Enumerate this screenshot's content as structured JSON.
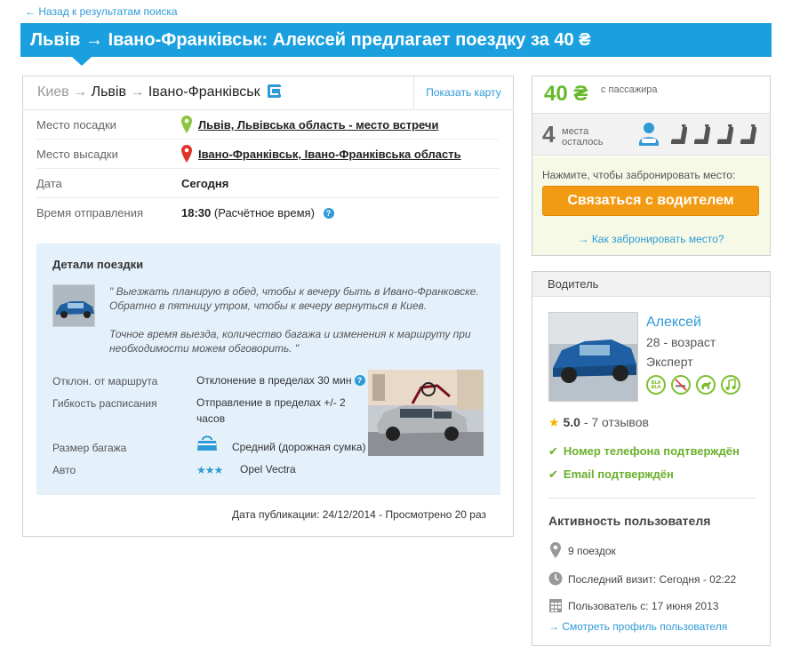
{
  "nav": {
    "back_label": "← Назад к результатам поиска"
  },
  "header": {
    "title": "Львів → Івано-Франківськ: Алексей предлагает поездку за 40 ₴"
  },
  "route": {
    "from": "Киев",
    "via": "Львів",
    "to": "Івано-Франківськ",
    "arrow": "→",
    "icon": "highway-icon",
    "map_button": "Показать карту"
  },
  "trip_info": {
    "pickup_label": "Место посадки",
    "pickup_value": "Львів, Львівська область - место встречи",
    "dropoff_label": "Место высадки",
    "dropoff_value": "Івано-Франківськ, Івано-Франківська область",
    "date_label": "Дата",
    "date_value": "Сегодня",
    "time_label": "Время отправления",
    "time_value": "18:30",
    "time_note": "(Расчётное время)"
  },
  "details": {
    "title": "Детали поездки",
    "quote_1": "\" Выезжать планирую в обед, чтобы к вечеру быть в Ивано-Франковске. Обратно в пятницу утром, чтобы к вечеру вернуться в Киев.",
    "quote_2": "Точное время выезда, количество багажа и изменения к маршруту при необходимости можем обговорить. \"",
    "detour_label": "Отклон. от маршрута",
    "detour_value": "Отклонение в пределах 30 мин",
    "flex_label": "Гибкость расписания",
    "flex_value": "Отправление в пределах +/- 2 часов",
    "luggage_label": "Размер багажа",
    "luggage_value": "Средний (дорожная сумка)",
    "car_label": "Авто",
    "car_stars": "★★★",
    "car_value": "Opel Vectra"
  },
  "publication": {
    "text": "Дата публикации: 24/12/2014 - Просмотрено 20 раз"
  },
  "booking": {
    "price": "40 ₴",
    "price_unit": "с пассажира",
    "seats_left": "4",
    "seats_label": "места осталось",
    "hint": "Нажмите, чтобы забронировать место:",
    "contact_button": "Связаться с водителем",
    "how_to_book": "→ Как забронировать место?"
  },
  "driver": {
    "section_title": "Водитель",
    "name": "Алексей",
    "age": "28 - возраст",
    "level": "Эксперт",
    "preferences": [
      "bla-bla-icon",
      "no-smoking-icon",
      "pets-icon",
      "music-icon"
    ],
    "pref_bla_text": "BLA",
    "rating_value": "5.0",
    "rating_reviews": "- 7 отзывов",
    "phone_verified": "Номер телефона подтверждён",
    "email_verified": "Email подтверждён",
    "activity_title": "Активность пользователя",
    "trips": "9 поездок",
    "last_visit": "Последний визит: Сегодня - 02:22",
    "member_since": "Пользователь с: 17 июня 2013",
    "profile_link": "→ Смотреть профиль пользователя"
  },
  "colors": {
    "accent_blue": "#1ba0df",
    "link_blue": "#2e9ad6",
    "price_green": "#67b92c",
    "button_orange": "#f39a13"
  }
}
